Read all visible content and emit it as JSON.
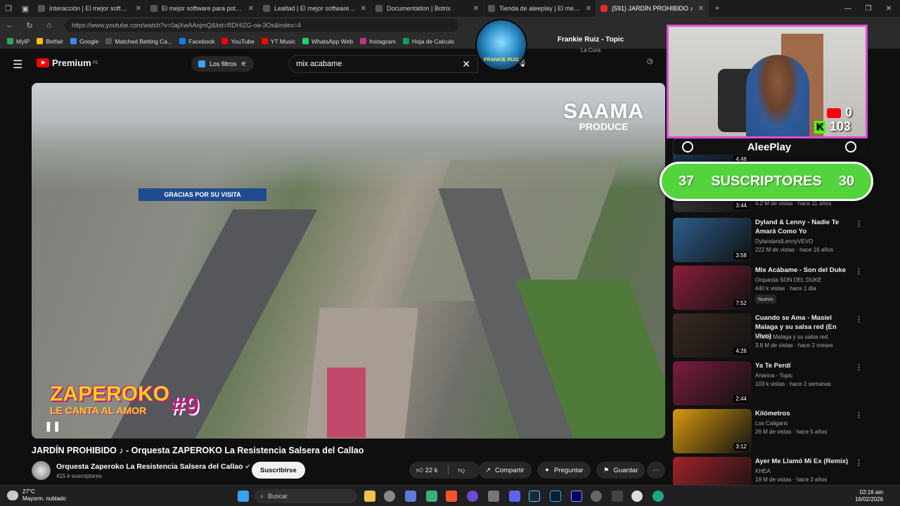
{
  "browser": {
    "tabs": [
      {
        "title": "Interacción | El mejor software pa",
        "yt": false
      },
      {
        "title": "El mejor software para potenciar",
        "yt": false
      },
      {
        "title": "Lealtad | El mejor software para p",
        "yt": false
      },
      {
        "title": "Documentation | Botrix",
        "yt": false
      },
      {
        "title": "Tienda de aleeplay | El mejor softw",
        "yt": false
      },
      {
        "title": "(591) JARDÍN PROHIBIDO ♪",
        "yt": true
      }
    ],
    "url": "https://www.youtube.com/watch?v=0ajXwAAojmQ&list=RDHIZG-oa-3Os&index=4",
    "bookmarks": [
      {
        "label": "MyIP",
        "color": "#2fa84f"
      },
      {
        "label": "Betfair",
        "color": "#f5c400"
      },
      {
        "label": "Google",
        "color": "#4285f4"
      },
      {
        "label": "Matched Betting Ca...",
        "color": "#555555"
      },
      {
        "label": "Facebook",
        "color": "#1877f2"
      },
      {
        "label": "YouTube",
        "color": "#ff0000"
      },
      {
        "label": "YT Music",
        "color": "#ff0000"
      },
      {
        "label": "WhatsApp Web",
        "color": "#25d366"
      },
      {
        "label": "Instagram",
        "color": "#c13584"
      },
      {
        "label": "Hoja de Calculo",
        "color": "#0f9d58"
      }
    ]
  },
  "youtube": {
    "logo": "Premium",
    "logo_region": "PE",
    "filters_label": "Los filtros",
    "search_value": "mix acabame"
  },
  "now_playing": {
    "avatar_label": "FRANKIE RUIZ",
    "artist": "Frankie Ruiz - Topic",
    "song": "La Cura"
  },
  "video": {
    "sign_text": "GRACIAS POR SU VISITA",
    "brand_line1": "SAAMA",
    "brand_line2": "PRODUCE",
    "overlay_title": "ZAPEROKO",
    "overlay_sub": "LE CANTA AL AMOR",
    "overlay_num": "#9",
    "title": "JARDÍN PROHIBIDO ♪ - Orquesta ZAPEROKO La Resistencia Salsera del Callao"
  },
  "channel": {
    "name": "Orquesta Zaperoko La Resistencia Salsera del Callao",
    "subscribers": "415 k suscriptores",
    "subscribe_label": "Suscribirse"
  },
  "actions": {
    "likes": "22 k",
    "share": "Compartir",
    "ask": "Preguntar",
    "save": "Guardar"
  },
  "stream_overlay": {
    "youtube_count": "0",
    "kick_count": "103",
    "streamer_name": "AleePlay",
    "goal_current": "37",
    "goal_label": "SUSCRIPTORES",
    "goal_target": "30"
  },
  "recommendations": [
    {
      "duration": "4:48",
      "title": "",
      "channel": "",
      "meta": "",
      "badge": ""
    },
    {
      "duration": "3:44",
      "title": "",
      "channel": "",
      "meta": "4.2 M de vistas · hace 11 años",
      "badge": ""
    },
    {
      "duration": "3:58",
      "title": "Dyland & Lenny - Nadie Te Amará Como Yo",
      "channel": "DylandandLennyVEVO",
      "meta": "222 M de vistas · hace 16 años",
      "badge": ""
    },
    {
      "duration": "7:52",
      "title": "Mix Acábame - Son del Duke",
      "channel": "Orquesta SON DEL DUKE",
      "meta": "440 k vistas · hace 1 día",
      "badge": "Nuevo"
    },
    {
      "duration": "4:26",
      "title": "Cuando se Ama - Masiel Malaga y su salsa red (En Vivo)",
      "channel": "Masiel Malaga y su salsa red",
      "meta": "3.8 M de vistas · hace 2 meses",
      "badge": ""
    },
    {
      "duration": "2:44",
      "title": "Ya Te Perdí",
      "channel": "Arianna - Topic",
      "meta": "103 k vistas · hace 2 semanas",
      "badge": ""
    },
    {
      "duration": "3:12",
      "title": "Kilómetros",
      "channel": "Los Caligaris",
      "meta": "26 M de vistas · hace 5 años",
      "badge": ""
    },
    {
      "duration": "",
      "title": "Ayer Me Llamó Mi Ex (Remix)",
      "channel": "KHEA",
      "meta": "19 M de vistas · hace 3 años",
      "badge": ""
    }
  ],
  "taskbar": {
    "temp": "27°C",
    "weather": "Mayorm. nublado",
    "search": "Buscar",
    "time": "02:16 am",
    "date": "16/02/2026"
  }
}
